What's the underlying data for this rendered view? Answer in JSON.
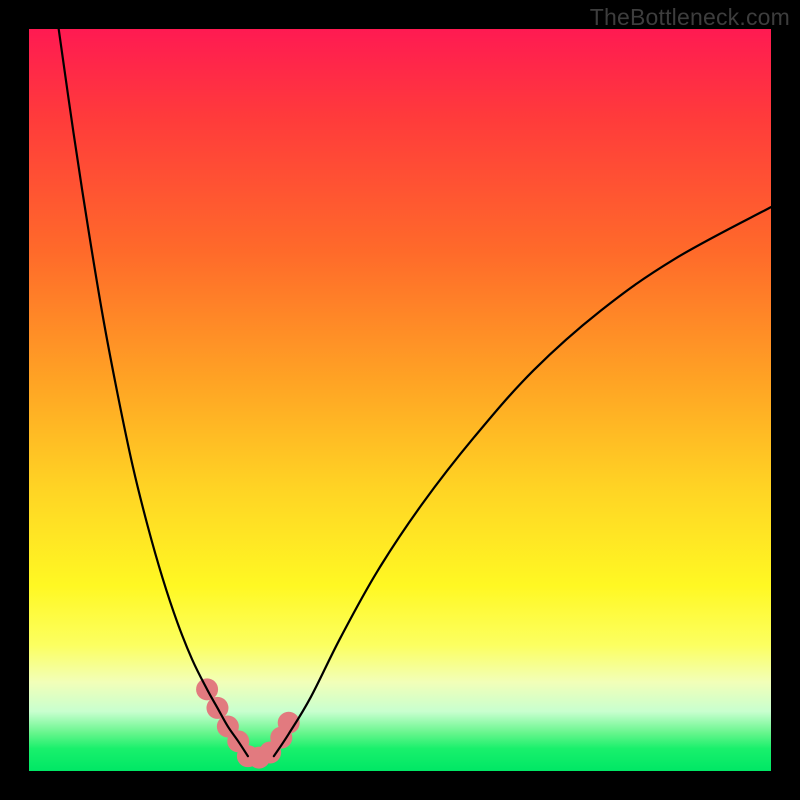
{
  "watermark": "TheBottleneck.com",
  "chart_data": {
    "type": "line",
    "title": "",
    "xlabel": "",
    "ylabel": "",
    "xlim": [
      0,
      100
    ],
    "ylim": [
      0,
      100
    ],
    "series": [
      {
        "name": "left-curve",
        "x": [
          4.0,
          6.0,
          8.0,
          10.0,
          12.0,
          14.0,
          16.0,
          18.0,
          20.0,
          22.0,
          24.0,
          25.4,
          26.8,
          28.2,
          29.5
        ],
        "y": [
          100.0,
          86.0,
          73.0,
          61.0,
          50.5,
          41.0,
          33.0,
          26.0,
          20.0,
          15.0,
          11.0,
          8.5,
          6.0,
          4.0,
          2.0
        ]
      },
      {
        "name": "right-curve",
        "x": [
          33.0,
          35.0,
          38.0,
          42.0,
          47.0,
          53.0,
          60.0,
          68.0,
          77.0,
          87.0,
          100.0
        ],
        "y": [
          2.0,
          5.0,
          10.0,
          18.0,
          27.0,
          36.0,
          45.0,
          54.0,
          62.0,
          69.0,
          76.0
        ]
      },
      {
        "name": "bottom-markers",
        "x": [
          24.0,
          25.4,
          26.8,
          28.2,
          29.5,
          31.0,
          32.5,
          34.0,
          35.0
        ],
        "y": [
          11.0,
          8.5,
          6.0,
          4.0,
          2.0,
          1.8,
          2.5,
          4.5,
          6.5
        ]
      }
    ],
    "colors": {
      "curve": "#000000",
      "marker": "#e27a7f"
    }
  }
}
